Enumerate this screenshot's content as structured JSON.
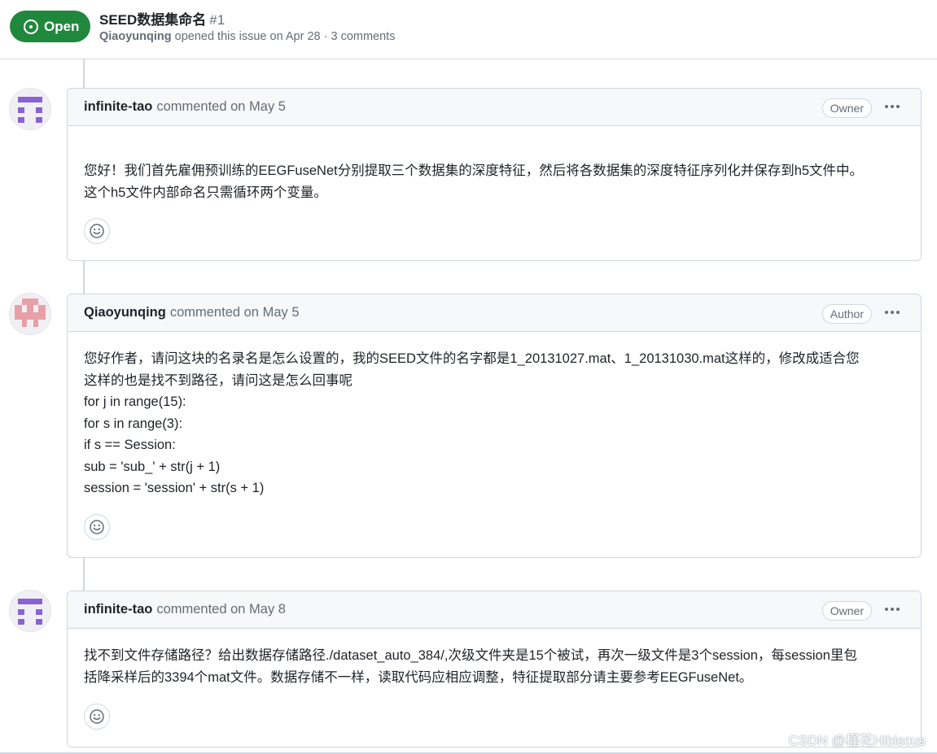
{
  "issue": {
    "state": "Open",
    "title": "SEED数据集命名",
    "number": "#1",
    "author": "Qiaoyunqing",
    "meta_rest": "opened this issue on Apr 28 · 3 comments"
  },
  "comments": [
    {
      "login": "infinite-tao",
      "action": "commented on May 5",
      "role": "Owner",
      "avatar_color": "#8a63d2",
      "lines": [
        "您好！我们首先雇佣预训练的EEGFuseNet分别提取三个数据集的深度特征，然后将各数据集的深度特征序列化并保存到h5文件中。",
        "这个h5文件内部命名只需循环两个变量。"
      ]
    },
    {
      "login": "Qiaoyunqing",
      "action": "commented on May 5",
      "role": "Author",
      "avatar_color": "#e8a0a8",
      "lines": [
        "您好作者，请问这块的名录名是怎么设置的，我的SEED文件的名字都是1_20131027.mat、1_20131030.mat这样的，修改成适合您",
        "这样的也是找不到路径，请问这是怎么回事呢",
        "for j in range(15):",
        "for s in range(3):",
        "if s == Session:",
        "sub = 'sub_' + str(j + 1)",
        "session = 'session' + str(s + 1)"
      ]
    },
    {
      "login": "infinite-tao",
      "action": "commented on May 8",
      "role": "Owner",
      "avatar_color": "#8a63d2",
      "lines": [
        "找不到文件存储路径？给出数据存储路径./dataset_auto_384/,次级文件夹是15个被试，再次一级文件是3个session，每session里包",
        "括降采样后的3394个mat文件。数据存储不一样，读取代码应相应调整，特征提取部分请主要参考EEGFuseNet。"
      ]
    }
  ],
  "icons": {
    "state": "issue-opened-icon",
    "reaction": "smiley-icon",
    "menu": "kebab-horizontal-icon"
  },
  "colors": {
    "open_green": "#1f883d",
    "border": "#d0d7de",
    "muted": "#656d76"
  },
  "watermark": "CSDN @槿花Hibiscus"
}
